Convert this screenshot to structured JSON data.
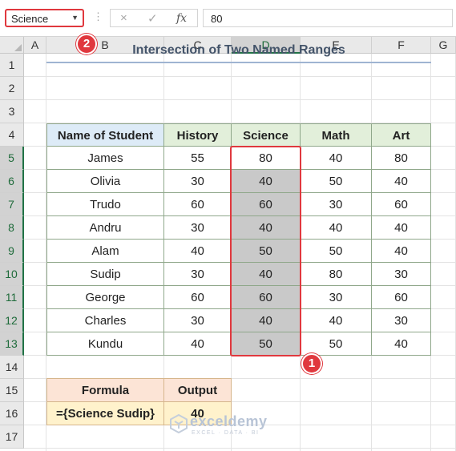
{
  "formula_bar": {
    "name_box": "Science",
    "formula": "80",
    "fx_label": "fx",
    "cancel_icon": "×",
    "enter_icon": "✓",
    "dots": "⋮"
  },
  "badges": {
    "one": "1",
    "two": "2"
  },
  "columns": [
    "A",
    "B",
    "C",
    "D",
    "E",
    "F",
    "G"
  ],
  "rows": [
    "1",
    "2",
    "3",
    "4",
    "5",
    "6",
    "7",
    "8",
    "9",
    "10",
    "11",
    "12",
    "13",
    "14",
    "15",
    "16",
    "17"
  ],
  "sheet": {
    "title": "Intersection of Two Named Ranges",
    "headers": [
      "Name of Student",
      "History",
      "Science",
      "Math",
      "Art"
    ],
    "data": [
      [
        "James",
        "55",
        "80",
        "40",
        "80"
      ],
      [
        "Olivia",
        "30",
        "40",
        "50",
        "40"
      ],
      [
        "Trudo",
        "60",
        "60",
        "30",
        "60"
      ],
      [
        "Andru",
        "30",
        "40",
        "40",
        "40"
      ],
      [
        "Alam",
        "40",
        "50",
        "50",
        "40"
      ],
      [
        "Sudip",
        "30",
        "40",
        "80",
        "30"
      ],
      [
        "George",
        "60",
        "60",
        "30",
        "60"
      ],
      [
        "Charles",
        "30",
        "40",
        "40",
        "30"
      ],
      [
        "Kundu",
        "40",
        "50",
        "50",
        "40"
      ]
    ],
    "formula_table": {
      "headers": [
        "Formula",
        "Output"
      ],
      "formula": "={Science Sudip}",
      "output": "40"
    }
  },
  "watermark": {
    "name": "exceldemy",
    "tagline": "EXCEL · DATA · BI"
  },
  "colors": {
    "highlight_red": "#e0383e",
    "header_green": "#e2efda",
    "header_blue": "#ddebf7",
    "formula_header": "#fce4d6",
    "formula_value": "#fff2cc",
    "selected_shade": "#c9c9c9"
  }
}
